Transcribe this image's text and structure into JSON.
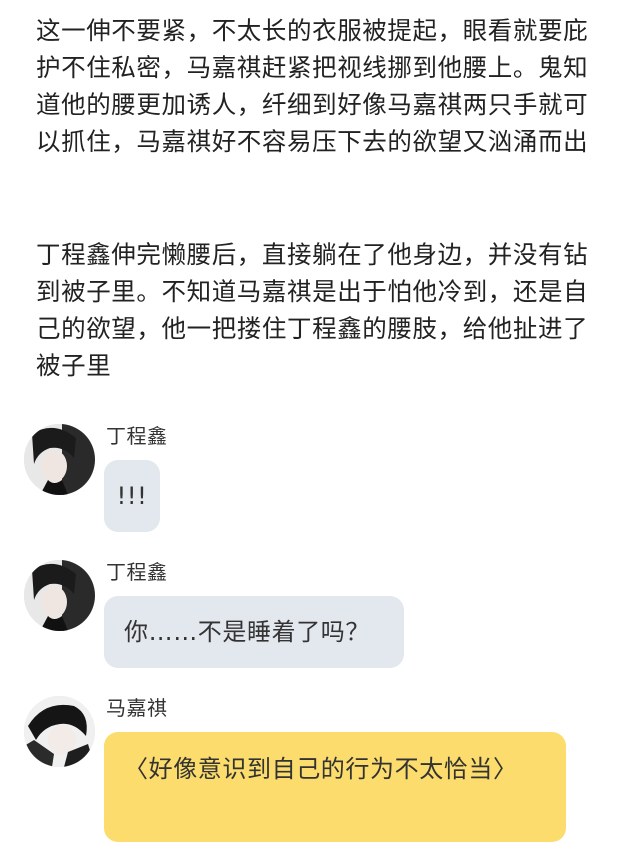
{
  "story": {
    "paragraph_1": "这一伸不要紧，不太长的衣服被提起，眼看就要庇护不住私密，马嘉祺赶紧把视线挪到他腰上。鬼知道他的腰更加诱人，纤细到好像马嘉祺两只手就可以抓住，马嘉祺好不容易压下去的欲望又汹涌而出",
    "paragraph_2": "丁程鑫伸完懒腰后，直接躺在了他身边，并没有钻到被子里。不知道马嘉祺是出于怕他冷到，还是自己的欲望，他一把搂住丁程鑫的腰肢，给他扯进了被子里"
  },
  "chat": {
    "messages": [
      {
        "sender": "丁程鑫",
        "text": "!!!",
        "bubble_color": "#e3e7ee",
        "avatar": "avatar-icon"
      },
      {
        "sender": "丁程鑫",
        "text": "你……不是睡着了吗？",
        "bubble_color": "#e3e7ee",
        "avatar": "avatar-icon"
      },
      {
        "sender": "马嘉祺",
        "text": "〈好像意识到自己的行为不太恰当〉",
        "bubble_color": "#fbdc6c",
        "avatar": "avatar-icon"
      }
    ]
  }
}
